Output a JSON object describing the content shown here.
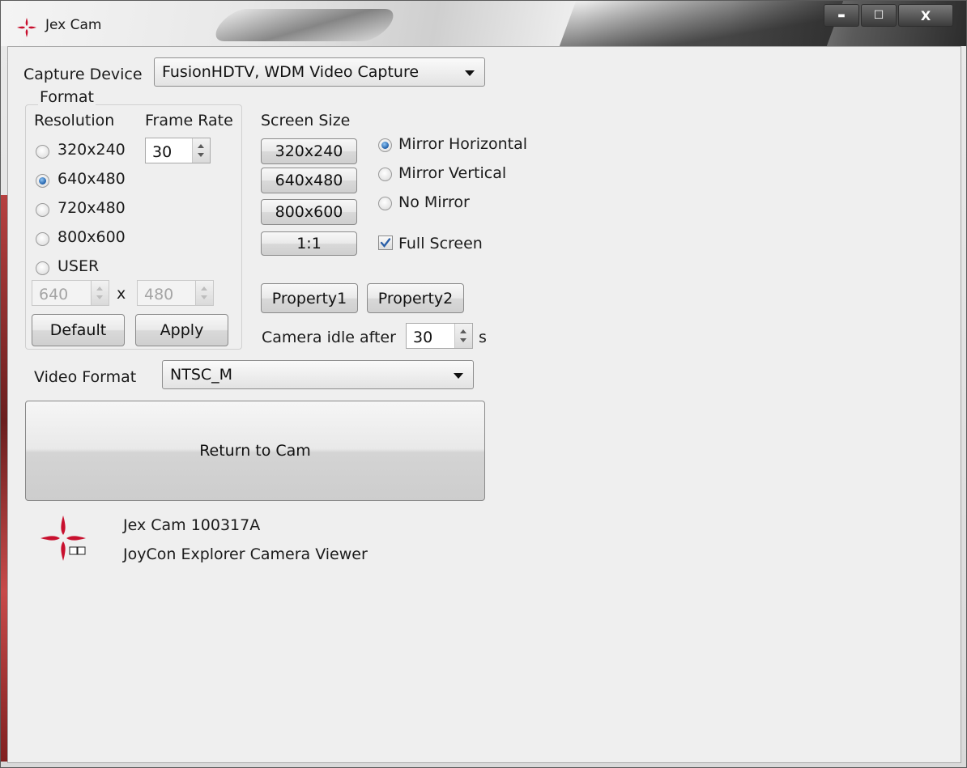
{
  "window": {
    "title": "Jex Cam",
    "minimize_label": "▬",
    "maximize_label": "☐",
    "close_label": "X"
  },
  "capture": {
    "label": "Capture Device",
    "value": "FusionHDTV, WDM Video Capture"
  },
  "format": {
    "group_label": "Format",
    "resolution_label": "Resolution",
    "framerate_label": "Frame Rate",
    "framerate_value": "30",
    "resolutions": [
      {
        "label": "320x240",
        "selected": false
      },
      {
        "label": "640x480",
        "selected": true
      },
      {
        "label": "720x480",
        "selected": false
      },
      {
        "label": "800x600",
        "selected": false
      },
      {
        "label": "USER",
        "selected": false
      }
    ],
    "user_width": "640",
    "user_height": "480",
    "times_label": "x",
    "default_button": "Default",
    "apply_button": "Apply"
  },
  "screen_size": {
    "label": "Screen Size",
    "buttons": [
      "320x240",
      "640x480",
      "800x600",
      "1:1"
    ]
  },
  "mirror": {
    "options": [
      {
        "label": "Mirror Horizontal",
        "selected": true
      },
      {
        "label": "Mirror Vertical",
        "selected": false
      },
      {
        "label": "No Mirror",
        "selected": false
      }
    ],
    "fullscreen_label": "Full Screen",
    "fullscreen_checked": true
  },
  "property1_button": "Property1",
  "property2_button": "Property2",
  "idle": {
    "label": "Camera idle after",
    "value": "30",
    "unit": "s"
  },
  "video_format": {
    "label": "Video Format",
    "value": "NTSC_M"
  },
  "return_button": "Return to Cam",
  "about": {
    "version": "Jex Cam 100317A",
    "description": "JoyCon Explorer Camera Viewer"
  },
  "colors": {
    "brand_red": "#c8102e",
    "radio_blue": "#1e5ea8"
  }
}
